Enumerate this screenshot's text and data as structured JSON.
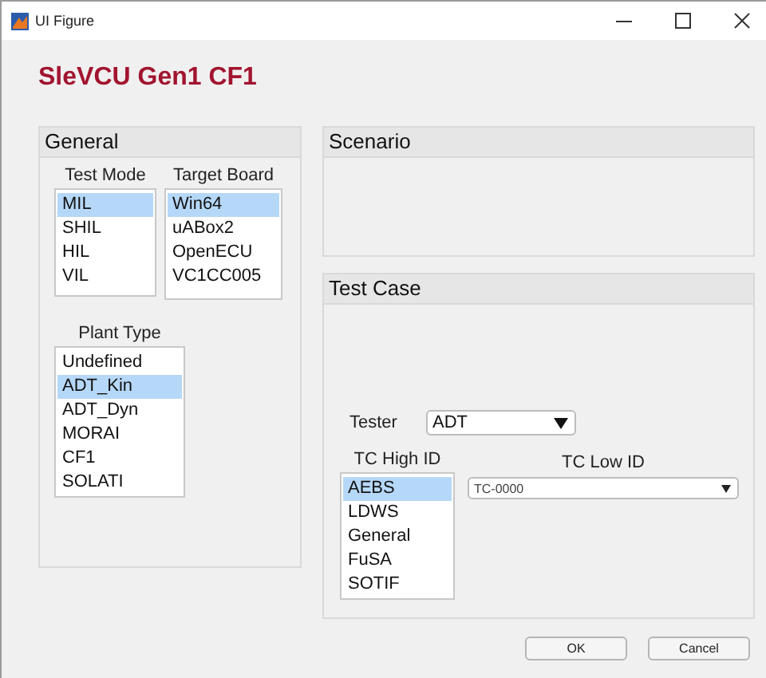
{
  "window": {
    "title": "UI Figure"
  },
  "heading": "SleVCU Gen1 CF1",
  "general": {
    "title": "General",
    "test_mode": {
      "label": "Test Mode",
      "items": [
        {
          "text": "MIL",
          "selected": true
        },
        {
          "text": "SHIL",
          "selected": false
        },
        {
          "text": "HIL",
          "selected": false
        },
        {
          "text": "VIL",
          "selected": false
        }
      ]
    },
    "target_board": {
      "label": "Target Board",
      "items": [
        {
          "text": "Win64",
          "selected": true
        },
        {
          "text": "uABox2",
          "selected": false
        },
        {
          "text": "OpenECU",
          "selected": false
        },
        {
          "text": "VC1CC005",
          "selected": false
        }
      ]
    },
    "plant_type": {
      "label": "Plant Type",
      "items": [
        {
          "text": "Undefined",
          "selected": false
        },
        {
          "text": "ADT_Kin",
          "selected": true
        },
        {
          "text": "ADT_Dyn",
          "selected": false
        },
        {
          "text": "MORAI",
          "selected": false
        },
        {
          "text": "CF1",
          "selected": false
        },
        {
          "text": "SOLATI",
          "selected": false
        }
      ]
    }
  },
  "scenario": {
    "title": "Scenario"
  },
  "test_case": {
    "title": "Test Case",
    "tester": {
      "label": "Tester",
      "value": "ADT"
    },
    "tc_high_id": {
      "label": "TC High ID",
      "items": [
        {
          "text": "AEBS",
          "selected": true
        },
        {
          "text": "LDWS",
          "selected": false
        },
        {
          "text": "General",
          "selected": false
        },
        {
          "text": "FuSA",
          "selected": false
        },
        {
          "text": "SOTIF",
          "selected": false
        }
      ]
    },
    "tc_low_id": {
      "label": "TC Low ID",
      "value": "TC-0000"
    }
  },
  "buttons": [
    {
      "label": "OK"
    },
    {
      "label": "Cancel"
    }
  ]
}
